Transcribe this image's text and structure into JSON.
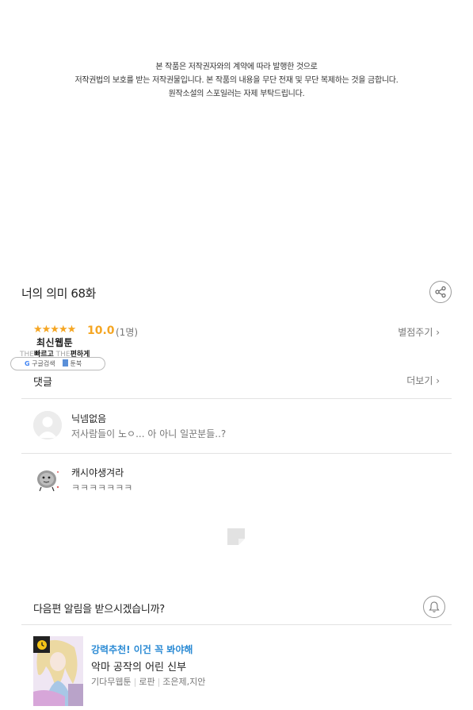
{
  "copyright": {
    "line1": "본 작품은 저작권자와의 계약에 따라 발행한 것으로",
    "line2": "저작권법의 보호를 받는 저작권물입니다. 본 작품의 내용을 무단 전재 및 무단 복제하는 것을 금합니다.",
    "line3": "원작소설의 스포일러는 자제 부탁드립니다."
  },
  "episode": {
    "title": "너의 의미 68화"
  },
  "rating": {
    "stars": "★★★★★",
    "score": "10.0",
    "count": "(1명)",
    "rate_link": "별점주기",
    "value": 10.0,
    "max": 10
  },
  "badge": {
    "title": "최신웹툰",
    "sub_the1": "THE",
    "sub_fast": "빠르고",
    "sub_the2": "THE",
    "sub_easy": "편하게",
    "google_label": "구글검색",
    "google_icon": "G",
    "toonbook_label": "툰북"
  },
  "comments": {
    "label": "댓글",
    "more_link": "더보기",
    "items": [
      {
        "name": "닉넴없음",
        "text": "저사람들이 노ㅇ... 아 아니 일꾼분들..?"
      },
      {
        "name": "캐시야생겨라",
        "text": "ㅋㅋㅋㅋㅋㅋㅋ"
      }
    ]
  },
  "notify": {
    "text": "다음편 알림을 받으시겠습니까?"
  },
  "recommend": {
    "tag": "강력추천! 이건 꼭 봐야해",
    "title": "악마 공작의 어린 신부",
    "genre": "기다무웹툰",
    "category": "로판",
    "authors": "조은제,지안"
  },
  "colors": {
    "accent_star": "#f5a623",
    "accent_blue": "#2a8ad4"
  }
}
